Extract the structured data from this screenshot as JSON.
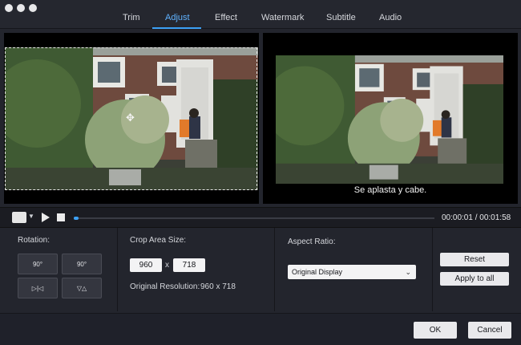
{
  "tabs": [
    {
      "label": "Trim"
    },
    {
      "label": "Adjust"
    },
    {
      "label": "Effect"
    },
    {
      "label": "Watermark"
    },
    {
      "label": "Subtitle"
    },
    {
      "label": "Audio"
    }
  ],
  "active_tab": "Adjust",
  "preview": {
    "subtitle_text": "Se aplasta y cabe."
  },
  "playback": {
    "current_time": "00:00:01",
    "total_time": "00:01:58",
    "time_separator": "/",
    "progress_fraction": 0.01
  },
  "rotation": {
    "label": "Rotation:",
    "rotate_left_label": "90°",
    "rotate_right_label": "90°",
    "flip_horizontal_glyph": "▷|◁",
    "flip_vertical_glyph": "▽△"
  },
  "crop": {
    "label": "Crop Area Size:",
    "width": "960",
    "separator": "x",
    "height": "718",
    "original_resolution_label": "Original Resolution:",
    "original_resolution_value": "960 x 718"
  },
  "aspect": {
    "label": "Aspect Ratio:",
    "selected": "Original Display"
  },
  "actions": {
    "reset_label": "Reset",
    "apply_all_label": "Apply to all"
  },
  "footer": {
    "ok_label": "OK",
    "cancel_label": "Cancel"
  },
  "colors": {
    "accent": "#3ca0f5",
    "background": "#23252d"
  },
  "icons": {
    "snapshot": "camera-icon",
    "play": "play-icon",
    "stop": "stop-icon"
  }
}
